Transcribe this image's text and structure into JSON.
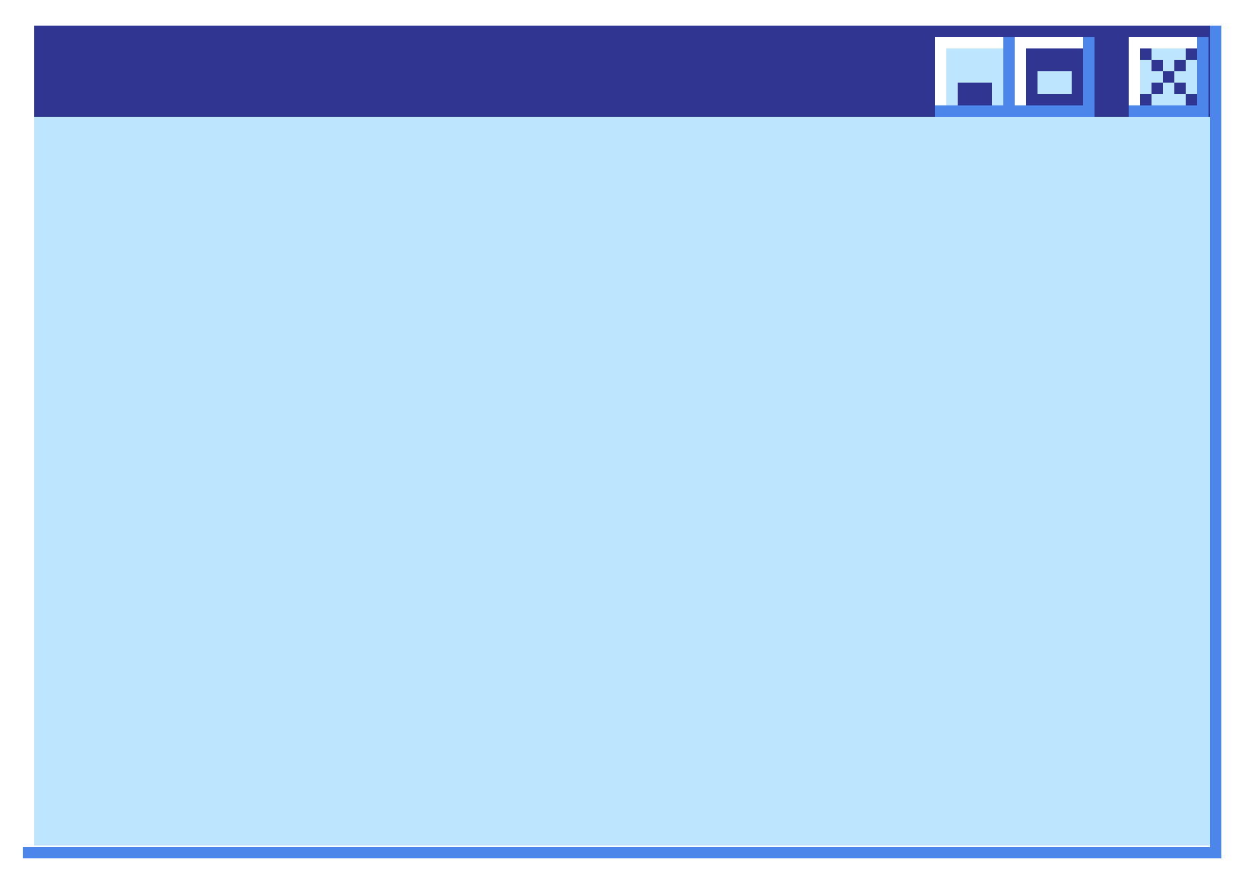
{
  "window": {
    "title": "",
    "colors": {
      "titlebar": "#2f3590",
      "body": "#bee5fe",
      "shadow": "#4d86eb",
      "highlight": "#ffffff"
    }
  },
  "titlebar_buttons": [
    {
      "name": "minimize",
      "icon": "minimize-icon"
    },
    {
      "name": "maximize",
      "icon": "maximize-icon"
    },
    {
      "name": "close",
      "icon": "close-icon"
    }
  ]
}
